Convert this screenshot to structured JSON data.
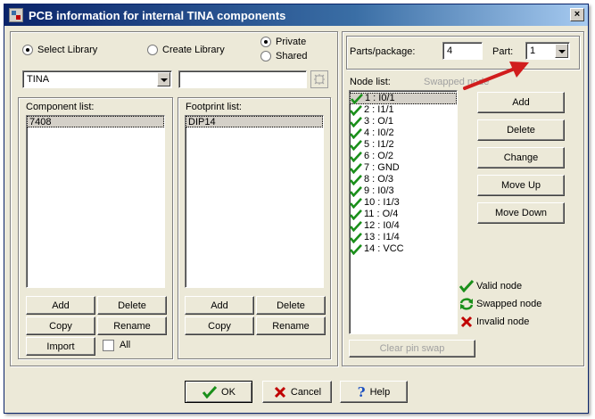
{
  "window": {
    "title": "PCB information for internal TINA components"
  },
  "library": {
    "select_label": "Select Library",
    "create_label": "Create Library",
    "private_label": "Private",
    "shared_label": "Shared",
    "selected_library": "TINA",
    "name_field_value": ""
  },
  "component_list": {
    "label": "Component list:",
    "items": [
      "7408"
    ],
    "add": "Add",
    "delete": "Delete",
    "copy": "Copy",
    "rename": "Rename",
    "import": "Import",
    "all": "All"
  },
  "footprint_list": {
    "label": "Footprint list:",
    "items": [
      "DIP14"
    ],
    "add": "Add",
    "delete": "Delete",
    "copy": "Copy",
    "rename": "Rename"
  },
  "parts": {
    "parts_per_package_label": "Parts/package:",
    "parts_per_package_value": "4",
    "part_label": "Part:",
    "part_value": "1"
  },
  "node_list": {
    "label": "Node list:",
    "swapped_label": "Swapped node",
    "items": [
      "1 : I0/1",
      "2 : I1/1",
      "3 : O/1",
      "4 : I0/2",
      "5 : I1/2",
      "6 : O/2",
      "7 : GND",
      "8 : O/3",
      "9 : I0/3",
      "10 : I1/3",
      "11 : O/4",
      "12 : I0/4",
      "13 : I1/4",
      "14 : VCC"
    ],
    "clear_swap": "Clear pin swap"
  },
  "node_buttons": {
    "add": "Add",
    "delete": "Delete",
    "change": "Change",
    "move_up": "Move Up",
    "move_down": "Move Down"
  },
  "legend": {
    "valid": "Valid node",
    "swapped": "Swapped node",
    "invalid": "Invalid node"
  },
  "footer": {
    "ok": "OK",
    "cancel": "Cancel",
    "help": "Help"
  },
  "colors": {
    "valid": "#1a8f1a",
    "invalid": "#c00000",
    "arrow": "#d11d1d"
  }
}
